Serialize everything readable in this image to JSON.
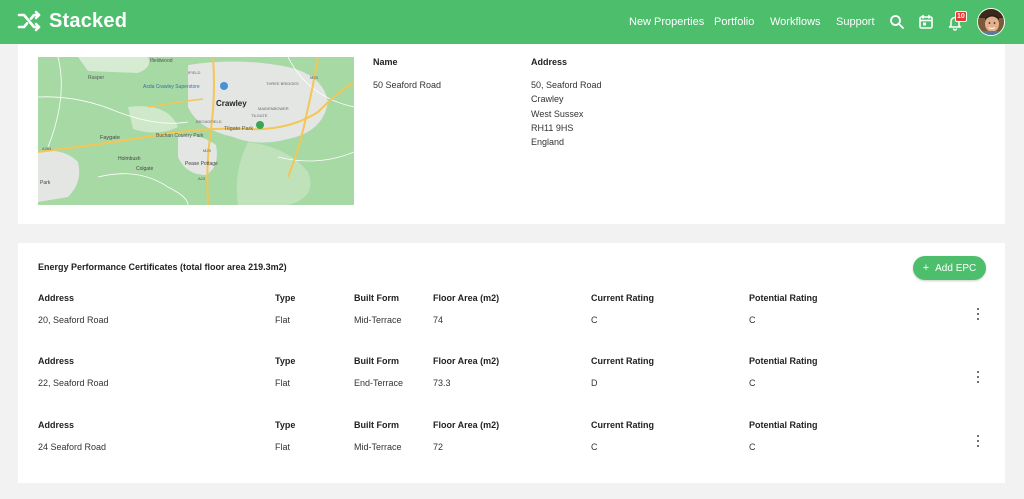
{
  "app": {
    "brand": "Stacked"
  },
  "nav": {
    "items": [
      "New Properties",
      "Portfolio",
      "Workflows",
      "Support"
    ]
  },
  "notifications": {
    "count": "10"
  },
  "property": {
    "name_label": "Name",
    "name_value": "50 Seaford Road",
    "address_label": "Address",
    "address_lines": [
      "50, Seaford Road",
      "Crawley",
      "West Sussex",
      "RH11 9HS",
      "England"
    ],
    "map_labels": [
      "Ifieldwood",
      "Rusper",
      "Asda Crawley Superstore",
      "THREE BRIDGES",
      "IFIELD",
      "Crawley",
      "MAIDENBOWER",
      "Faygate",
      "BROADFIELD",
      "Tilgate Park",
      "TILGATE",
      "Buchan Country Park",
      "Holmbush",
      "Colgate",
      "Pease Pottage",
      "Park",
      "M23",
      "A264",
      "A23",
      "M23"
    ]
  },
  "epc": {
    "title": "Energy Performance Certificates (total floor area 219.3m2)",
    "add_button": "Add EPC",
    "columns": [
      "Address",
      "Type",
      "Built Form",
      "Floor Area (m2)",
      "Current Rating",
      "Potential Rating"
    ],
    "rows": [
      [
        "20, Seaford Road",
        "Flat",
        "Mid-Terrace",
        "74",
        "C",
        "C"
      ],
      [
        "22, Seaford Road",
        "Flat",
        "End-Terrace",
        "73.3",
        "D",
        "C"
      ],
      [
        "24 Seaford Road",
        "Flat",
        "Mid-Terrace",
        "72",
        "C",
        "C"
      ]
    ]
  },
  "colors": {
    "brand": "#4cbe6c",
    "map_green": "#a6d9a4",
    "map_urban": "#e4e6e4",
    "road": "#f3c656"
  },
  "icons": [
    "shuffle-logo-icon",
    "search-icon",
    "calendar-icon",
    "bell-icon",
    "kebab-menu-icon",
    "plus-icon"
  ]
}
